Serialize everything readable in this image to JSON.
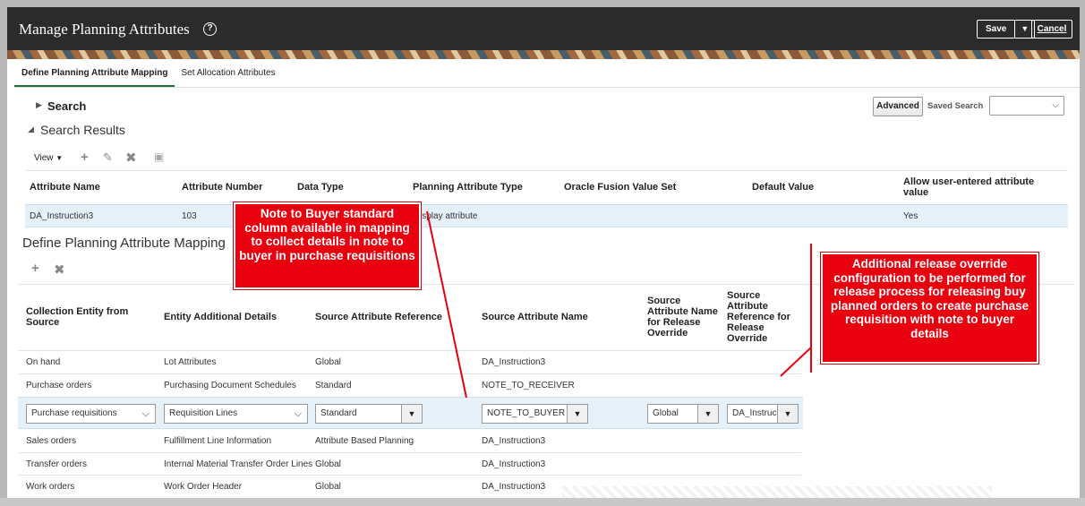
{
  "header": {
    "title": "Manage Planning Attributes",
    "save_label": "Save",
    "save_menu_icon": "▼",
    "cancel_label": "Cancel"
  },
  "tabs": [
    {
      "label": "Define Planning Attribute Mapping",
      "active": true
    },
    {
      "label": "Set Allocation Attributes",
      "active": false
    }
  ],
  "search": {
    "title": "Search",
    "advanced_label": "Advanced",
    "saved_search_label": "Saved Search",
    "saved_search_value": ""
  },
  "results": {
    "title": "Search Results",
    "view_label": "View",
    "columns": [
      "Attribute Name",
      "Attribute Number",
      "Data Type",
      "Planning Attribute Type",
      "Oracle Fusion Value Set",
      "Default Value",
      "Allow user-entered attribute value"
    ],
    "rows": [
      {
        "name": "DA_Instruction3",
        "number": "103",
        "data_type": "",
        "type": "isplay attribute",
        "value_set": "",
        "default": "",
        "allow": "Yes"
      }
    ]
  },
  "mapping": {
    "title": "Define Planning Attribute Mapping",
    "columns": [
      "Collection Entity from Source",
      "Entity Additional Details",
      "Source Attribute Reference",
      "Source Attribute Name",
      "Source Attribute Name for Release Override",
      "Source Attribute Reference for Release Override"
    ],
    "rows": [
      {
        "entity": "On hand",
        "details": "Lot Attributes",
        "reference": "Global",
        "name": "DA_Instruction3",
        "name_override": "",
        "ref_override": ""
      },
      {
        "entity": "Purchase orders",
        "details": "Purchasing Document Schedules",
        "reference": "Standard",
        "name": "NOTE_TO_RECEIVER",
        "name_override": "",
        "ref_override": ""
      },
      {
        "entity": "Purchase requisitions",
        "details": "Requisition Lines",
        "reference": "Standard",
        "name": "NOTE_TO_BUYER",
        "name_override": "Global",
        "ref_override": "DA_Instructi",
        "editable": true
      },
      {
        "entity": "Sales orders",
        "details": "Fulfillment Line Information",
        "reference": "Attribute Based Planning",
        "name": "DA_Instruction3",
        "name_override": "",
        "ref_override": ""
      },
      {
        "entity": "Transfer orders",
        "details": "Internal Material Transfer Order Lines",
        "reference": "Global",
        "name": "DA_Instruction3",
        "name_override": "",
        "ref_override": ""
      },
      {
        "entity": "Work orders",
        "details": "Work Order Header",
        "reference": "Global",
        "name": "DA_Instruction3",
        "name_override": "",
        "ref_override": ""
      }
    ]
  },
  "callouts": {
    "left": "Note to Buyer standard column available in mapping to collect details in note to buyer in purchase requisitions",
    "right": "Additional release override configuration to be performed for release process for releasing buy planned orders to create purchase requisition with note to buyer details"
  },
  "colors": {
    "header_bg": "#2b2b2b",
    "callout_red": "#e8000f",
    "selected_row": "#e6f0f9",
    "tab_accent": "#1d6f42"
  }
}
